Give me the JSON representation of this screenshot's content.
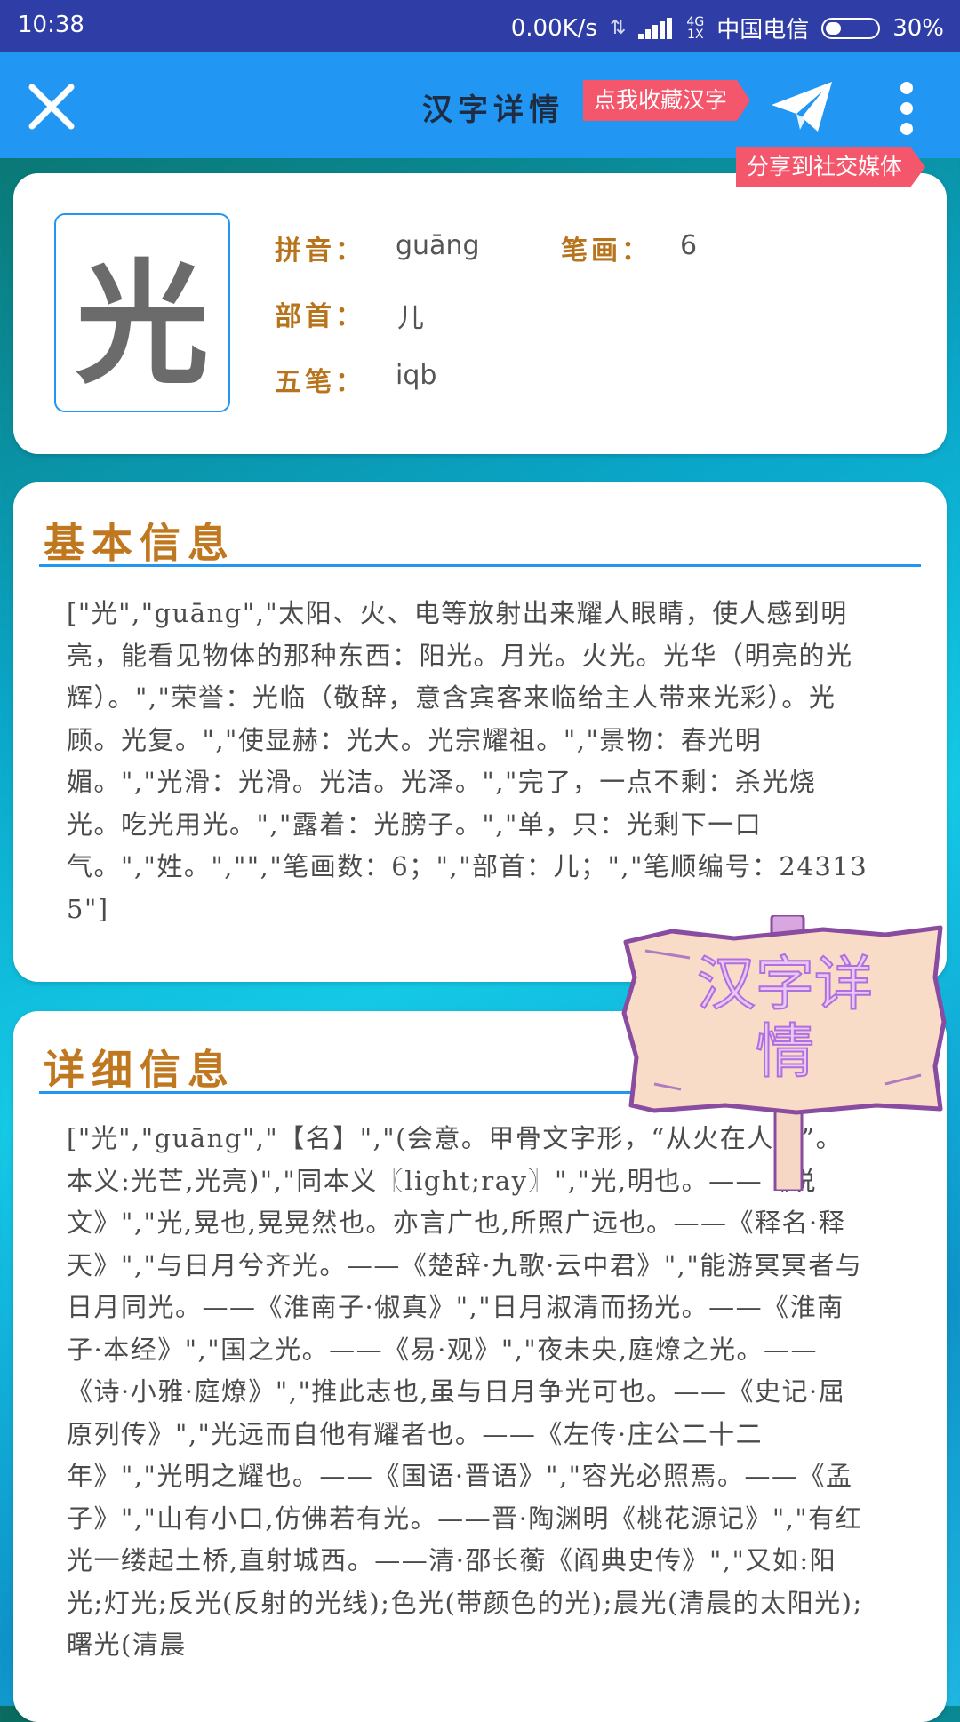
{
  "status_bar": {
    "time": "10:38",
    "speed": "0.00K/s",
    "network_small": "4G\n1X",
    "carrier": "中国电信",
    "battery_percent": 30,
    "battery_label": "30%"
  },
  "app_bar": {
    "title": "汉字详情",
    "favorite_tag": "点我收藏汉字",
    "share_tag": "分享到社交媒体",
    "icons": [
      "close-icon",
      "send-icon",
      "more-vertical-icon"
    ]
  },
  "character": {
    "glyph": "光",
    "pinyin_label": "拼音：",
    "pinyin": "guāng",
    "strokes_label": "笔画：",
    "strokes": "6",
    "radical_label": "部首：",
    "radical": "儿",
    "wubi_label": "五笔：",
    "wubi": "iqb"
  },
  "basic_info": {
    "title": "基本信息",
    "text": "[\"光\",\"guāng\",\"太阳、火、电等放射出来耀人眼睛，使人感到明亮，能看见物体的那种东西：阳光。月光。火光。光华（明亮的光辉）。\",\"荣誉：光临（敬辞，意含宾客来临给主人带来光彩）。光顾。光复。\",\"使显赫：光大。光宗耀祖。\",\"景物：春光明媚。\",\"光滑：光滑。光洁。光泽。\",\"完了，一点不剩：杀光烧光。吃光用光。\",\"露着：光膀子。\",\"单，只：光剩下一口气。\",\"姓。\",\"\",\"笔画数：6；\",\"部首：儿；\",\"笔顺编号：243135\"]"
  },
  "detail_info": {
    "title": "详细信息",
    "text": "[\"光\",\"guāng\",\"【名】\",\"(会意。甲骨文字形，“从火在人上”。本义:光芒,光亮)\",\"同本义〖light;ray〗\",\"光,明也。——《说文》\",\"光,晃也,晃晃然也。亦言广也,所照广远也。——《释名·释天》\",\"与日月兮齐光。——《楚辞·九歌·云中君》\",\"能游冥冥者与日月同光。——《淮南子·俶真》\",\"日月淑清而扬光。——《淮南子·本经》\",\"国之光。——《易·观》\",\"夜未央,庭燎之光。——《诗·小雅·庭燎》\",\"推此志也,虽与日月争光可也。——《史记·屈原列传》\",\"光远而自他有耀者也。——《左传·庄公二十二年》\",\"光明之耀也。——《国语·晋语》\",\"容光必照焉。——《孟子》\",\"山有小口,仿佛若有光。——晋·陶渊明《桃花源记》\",\"有红光一缕起土桥,直射城西。——清·邵长蘅《阎典史传》\",\"又如:阳光;灯光;反光(反射的光线);色光(带颜色的光);晨光(清晨的太阳光);曙光(清晨"
  },
  "signboard": {
    "text": "汉字详情"
  }
}
